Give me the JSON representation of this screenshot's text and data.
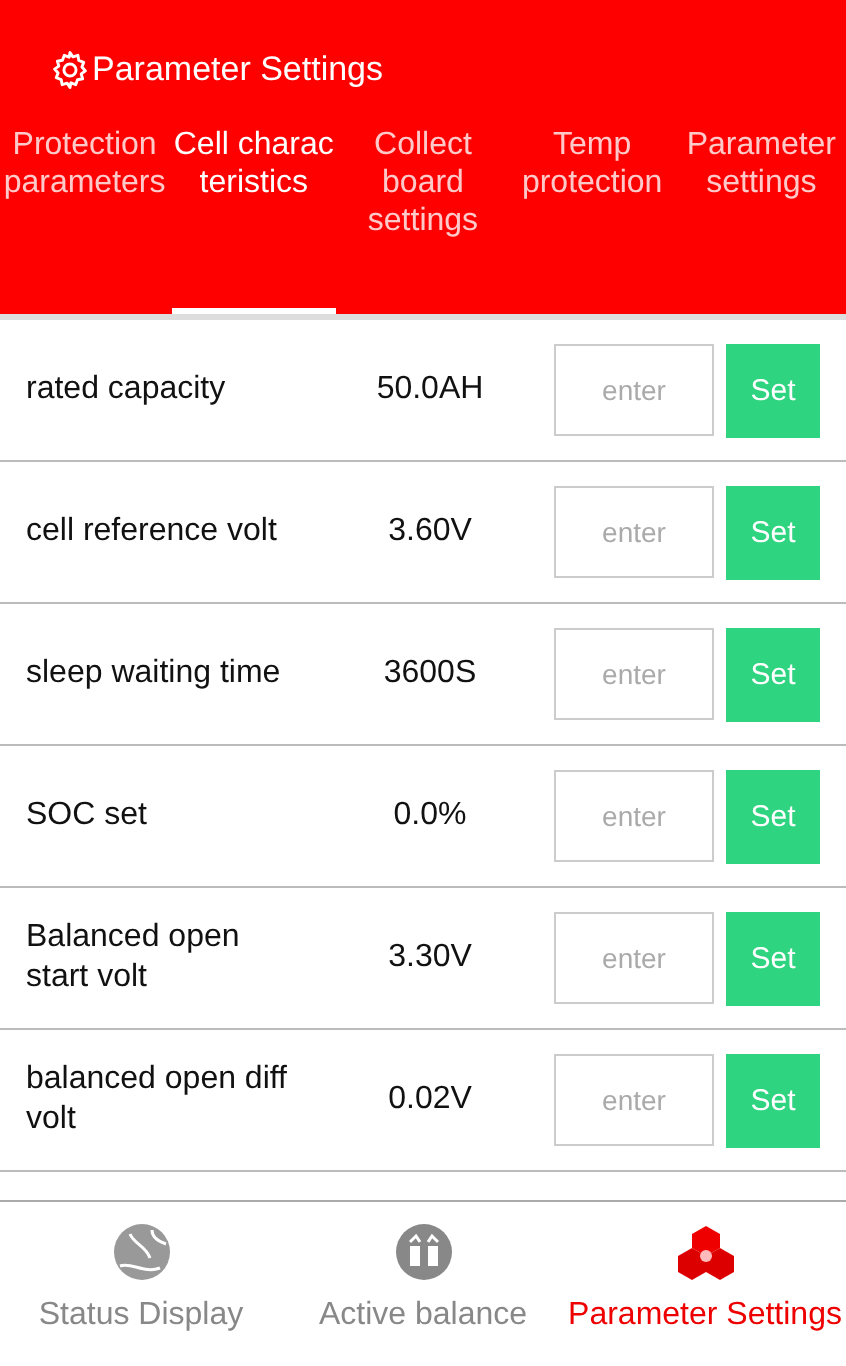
{
  "header": {
    "title": "Parameter Settings"
  },
  "tabs": [
    {
      "label": "Protection parameters",
      "selected": false
    },
    {
      "label": "Cell charac teristics",
      "selected": true
    },
    {
      "label": "Collect board settings",
      "selected": false
    },
    {
      "label": "Temp protection",
      "selected": false
    },
    {
      "label": "Parameter settings",
      "selected": false
    }
  ],
  "rows": [
    {
      "name": "rated capacity",
      "value": "50.0AH",
      "placeholder": "enter",
      "button": "Set"
    },
    {
      "name": "cell reference volt",
      "value": "3.60V",
      "placeholder": "enter",
      "button": "Set"
    },
    {
      "name": "sleep waiting time",
      "value": "3600S",
      "placeholder": "enter",
      "button": "Set"
    },
    {
      "name": "SOC set",
      "value": "0.0%",
      "placeholder": "enter",
      "button": "Set"
    },
    {
      "name": "Balanced open start volt",
      "value": "3.30V",
      "placeholder": "enter",
      "button": "Set"
    },
    {
      "name": "balanced open diff volt",
      "value": "0.02V",
      "placeholder": "enter",
      "button": "Set"
    }
  ],
  "nav": [
    {
      "label": "Status Display",
      "kind": "globe",
      "selected": false
    },
    {
      "label": "Active balance",
      "kind": "balance",
      "selected": false
    },
    {
      "label": "Parameter Settings",
      "kind": "cubes",
      "selected": true
    }
  ]
}
